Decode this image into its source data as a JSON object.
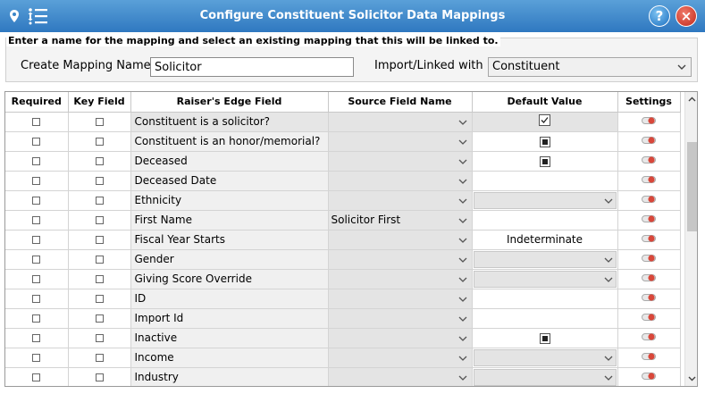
{
  "window": {
    "title": "Configure Constituent Solicitor Data Mappings",
    "help_label": "?",
    "close_label": "×"
  },
  "mapping": {
    "legend": "Enter a name for the mapping and select an existing mapping that this will be linked to.",
    "name_label": "Create Mapping Name",
    "name_value": "Solicitor",
    "import_label": "Import/Linked with",
    "import_value": "Constituent"
  },
  "columns": {
    "required": "Required",
    "key_field": "Key Field",
    "raisers_edge_field": "Raiser's Edge Field",
    "source_field_name": "Source Field Name",
    "default_value": "Default Value",
    "settings": "Settings"
  },
  "colors": {
    "title_bar": "#3a86c8",
    "toggle_red": "#d9473a"
  },
  "rows": [
    {
      "field": "Constituent is a solicitor?",
      "source": "",
      "default_type": "check-checked",
      "default_text": ""
    },
    {
      "field": "Constituent is an honor/memorial?",
      "source": "",
      "default_type": "check-filled",
      "default_text": ""
    },
    {
      "field": "Deceased",
      "source": "",
      "default_type": "check-filled",
      "default_text": ""
    },
    {
      "field": "Deceased Date",
      "source": "",
      "default_type": "blank",
      "default_text": ""
    },
    {
      "field": "Ethnicity",
      "source": "",
      "default_type": "dropdown",
      "default_text": ""
    },
    {
      "field": "First Name",
      "source": "Solicitor First",
      "default_type": "blank",
      "default_text": ""
    },
    {
      "field": "Fiscal Year Starts",
      "source": "",
      "default_type": "text",
      "default_text": "Indeterminate"
    },
    {
      "field": "Gender",
      "source": "",
      "default_type": "dropdown",
      "default_text": ""
    },
    {
      "field": "Giving Score Override",
      "source": "",
      "default_type": "dropdown",
      "default_text": ""
    },
    {
      "field": "ID",
      "source": "",
      "default_type": "blank",
      "default_text": ""
    },
    {
      "field": "Import Id",
      "source": "",
      "default_type": "blank",
      "default_text": ""
    },
    {
      "field": "Inactive",
      "source": "",
      "default_type": "check-filled",
      "default_text": ""
    },
    {
      "field": "Income",
      "source": "",
      "default_type": "dropdown",
      "default_text": ""
    },
    {
      "field": "Industry",
      "source": "",
      "default_type": "dropdown",
      "default_text": ""
    }
  ]
}
